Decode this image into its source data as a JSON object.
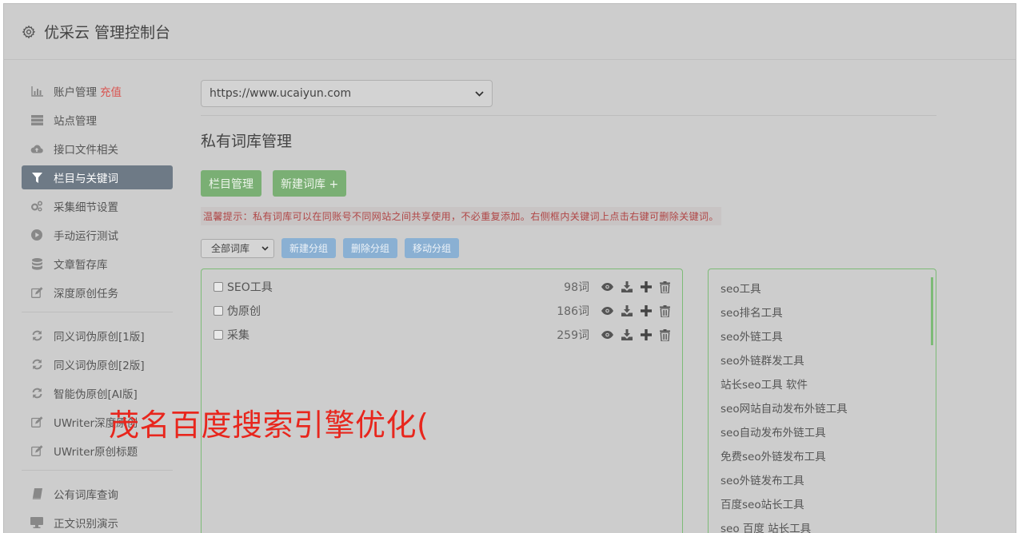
{
  "header": {
    "title": "优采云 管理控制台",
    "icon": "gear-icon"
  },
  "sidebar": {
    "items": [
      {
        "label": "账户管理",
        "badge": "充值",
        "icon": "bar-chart-icon"
      },
      {
        "label": "站点管理",
        "icon": "server-icon"
      },
      {
        "label": "接口文件相关",
        "icon": "cloud-upload-icon"
      },
      {
        "label": "栏目与关键词",
        "icon": "filter-icon",
        "active": true
      },
      {
        "label": "采集细节设置",
        "icon": "cogs-icon"
      },
      {
        "label": "手动运行测试",
        "icon": "play-circle-icon"
      },
      {
        "label": "文章暂存库",
        "icon": "database-icon"
      },
      {
        "label": "深度原创任务",
        "icon": "edit-icon"
      }
    ],
    "items2": [
      {
        "label": "同义词伪原创[1版]",
        "icon": "refresh-icon"
      },
      {
        "label": "同义词伪原创[2版]",
        "icon": "refresh-icon"
      },
      {
        "label": "智能伪原创[AI版]",
        "icon": "refresh-icon"
      },
      {
        "label": "UWriter深度原创",
        "icon": "edit-icon"
      },
      {
        "label": "UWriter原创标题",
        "icon": "edit-icon"
      }
    ],
    "items3": [
      {
        "label": "公有词库查询",
        "icon": "book-icon"
      },
      {
        "label": "正文识别演示",
        "icon": "monitor-icon"
      }
    ]
  },
  "main": {
    "site_url": "https://www.ucaiyun.com",
    "page_title": "私有词库管理",
    "buttons": {
      "column_manage": "栏目管理",
      "new_library": "新建词库 +"
    },
    "tip": "温馨提示：私有词库可以在同账号不同网站之间共享使用，不必重复添加。右侧框内关键词上点击右键可删除关键词。",
    "group_select": "全部词库",
    "group_buttons": {
      "new_group": "新建分组",
      "delete_group": "删除分组",
      "move_group": "移动分组"
    },
    "libraries": [
      {
        "name": "SEO工具",
        "count": "98词"
      },
      {
        "name": "伪原创",
        "count": "186词"
      },
      {
        "name": "采集",
        "count": "259词"
      }
    ],
    "keywords": [
      "seo工具",
      "seo排名工具",
      "seo外链工具",
      "seo外链群发工具",
      "站长seo工具 软件",
      "seo网站自动发布外链工具",
      "seo自动发布外链工具",
      "免费seo外链发布工具",
      "seo外链发布工具",
      "百度seo站长工具",
      "seo 百度 站长工具"
    ]
  },
  "overlay_text": "茂名百度搜索引擎优化(",
  "colors": {
    "active_nav": "#6e7a86",
    "green_button": "#7aaf74",
    "blue_button": "#8ab0d3",
    "tip_text": "#b04545",
    "overlay": "#e8261d"
  }
}
